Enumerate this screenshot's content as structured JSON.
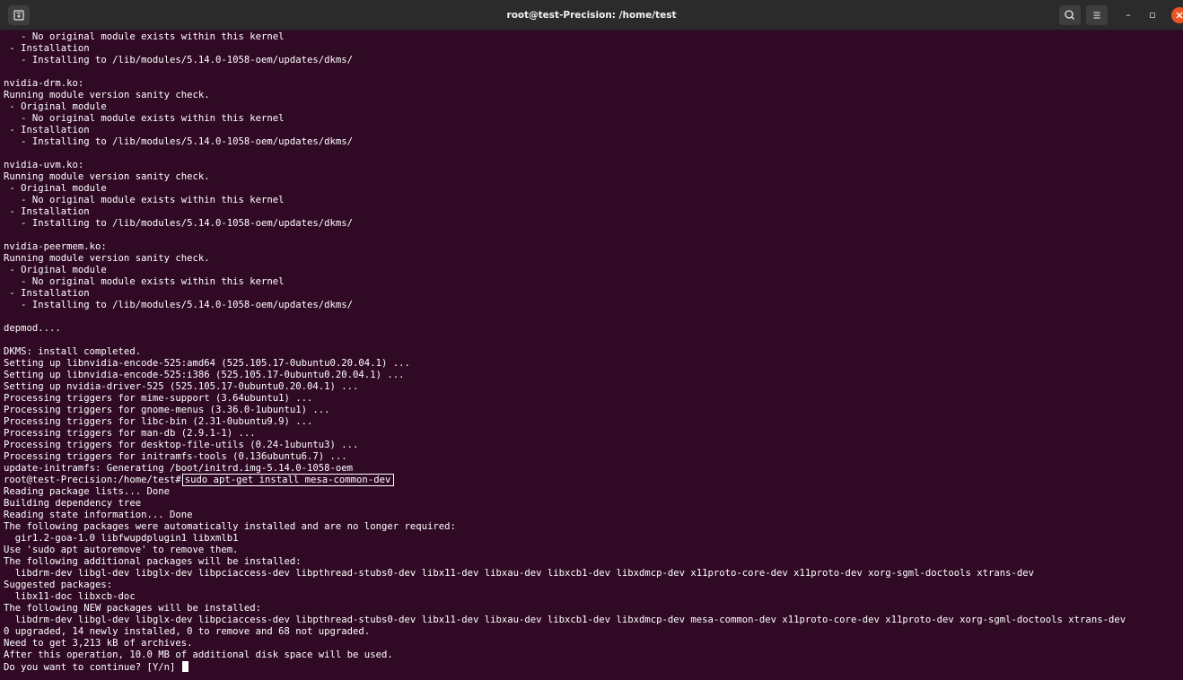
{
  "window": {
    "title": "root@test-Precision: /home/test"
  },
  "icons": {
    "new_tab": "new-tab-icon",
    "search": "search-icon",
    "menu": "hamburger-menu-icon",
    "minimize": "minimize-icon",
    "maximize": "maximize-icon",
    "close": "close-icon"
  },
  "window_controls": {
    "minimize_glyph": "–",
    "maximize_glyph": "▫"
  },
  "colors": {
    "terminal_bg": "#300a24",
    "titlebar_bg": "#2b2b2b",
    "close_button": "#e95420",
    "text": "#ffffff"
  },
  "terminal": {
    "lines": [
      "   - No original module exists within this kernel",
      " - Installation",
      "   - Installing to /lib/modules/5.14.0-1058-oem/updates/dkms/",
      "",
      "nvidia-drm.ko:",
      "Running module version sanity check.",
      " - Original module",
      "   - No original module exists within this kernel",
      " - Installation",
      "   - Installing to /lib/modules/5.14.0-1058-oem/updates/dkms/",
      "",
      "nvidia-uvm.ko:",
      "Running module version sanity check.",
      " - Original module",
      "   - No original module exists within this kernel",
      " - Installation",
      "   - Installing to /lib/modules/5.14.0-1058-oem/updates/dkms/",
      "",
      "nvidia-peermem.ko:",
      "Running module version sanity check.",
      " - Original module",
      "   - No original module exists within this kernel",
      " - Installation",
      "   - Installing to /lib/modules/5.14.0-1058-oem/updates/dkms/",
      "",
      "depmod....",
      "",
      "DKMS: install completed.",
      "Setting up libnvidia-encode-525:amd64 (525.105.17-0ubuntu0.20.04.1) ...",
      "Setting up libnvidia-encode-525:i386 (525.105.17-0ubuntu0.20.04.1) ...",
      "Setting up nvidia-driver-525 (525.105.17-0ubuntu0.20.04.1) ...",
      "Processing triggers for mime-support (3.64ubuntu1) ...",
      "Processing triggers for gnome-menus (3.36.0-1ubuntu1) ...",
      "Processing triggers for libc-bin (2.31-0ubuntu9.9) ...",
      "Processing triggers for man-db (2.9.1-1) ...",
      "Processing triggers for desktop-file-utils (0.24-1ubuntu3) ...",
      "Processing triggers for initramfs-tools (0.136ubuntu6.7) ...",
      "update-initramfs: Generating /boot/initrd.img-5.14.0-1058-oem"
    ],
    "prompt": "root@test-Precision:/home/test#",
    "command": "sudo apt-get install mesa-common-dev",
    "output": [
      "Reading package lists... Done",
      "Building dependency tree",
      "Reading state information... Done",
      "The following packages were automatically installed and are no longer required:",
      "  gir1.2-goa-1.0 libfwupdplugin1 libxmlb1",
      "Use 'sudo apt autoremove' to remove them.",
      "The following additional packages will be installed:",
      "  libdrm-dev libgl-dev libglx-dev libpciaccess-dev libpthread-stubs0-dev libx11-dev libxau-dev libxcb1-dev libxdmcp-dev x11proto-core-dev x11proto-dev xorg-sgml-doctools xtrans-dev",
      "Suggested packages:",
      "  libx11-doc libxcb-doc",
      "The following NEW packages will be installed:",
      "  libdrm-dev libgl-dev libglx-dev libpciaccess-dev libpthread-stubs0-dev libx11-dev libxau-dev libxcb1-dev libxdmcp-dev mesa-common-dev x11proto-core-dev x11proto-dev xorg-sgml-doctools xtrans-dev",
      "0 upgraded, 14 newly installed, 0 to remove and 68 not upgraded.",
      "Need to get 3,213 kB of archives.",
      "After this operation, 10.0 MB of additional disk space will be used."
    ],
    "question": "Do you want to continue? [Y/n] "
  }
}
